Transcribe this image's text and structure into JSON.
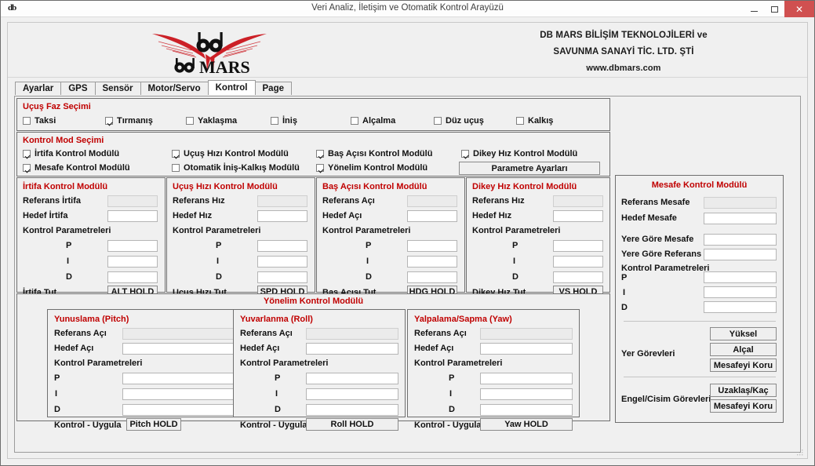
{
  "window": {
    "title": "Veri Analiz, İletişim ve Otomatik Kontrol Arayüzü",
    "icon_text": "db",
    "minimize_label": "",
    "maximize_label": "",
    "close_label": "✕"
  },
  "header": {
    "logo_text": "db MARS",
    "company_line1": "DB MARS BİLİŞİM TEKNOLOJİLERİ ve",
    "company_line2": "SAVUNMA SANAYİ TİC. LTD. ŞTİ",
    "website": "www.dbmars.com"
  },
  "tabs": [
    {
      "label": "Ayarlar",
      "active": false
    },
    {
      "label": "GPS",
      "active": false
    },
    {
      "label": "Sensör",
      "active": false
    },
    {
      "label": "Motor/Servo",
      "active": false
    },
    {
      "label": "Kontrol",
      "active": true
    },
    {
      "label": "Page",
      "active": false
    }
  ],
  "flight_phase": {
    "title": "Uçuş Faz Seçimi",
    "items": [
      {
        "label": "Taksi",
        "checked": false
      },
      {
        "label": "Tırmanış",
        "checked": true
      },
      {
        "label": "Yaklaşma",
        "checked": false
      },
      {
        "label": "İniş",
        "checked": false
      },
      {
        "label": "Alçalma",
        "checked": false
      },
      {
        "label": "Düz uçuş",
        "checked": false
      },
      {
        "label": "Kalkış",
        "checked": false
      }
    ]
  },
  "control_mode": {
    "title": "Kontrol Mod Seçimi",
    "items": [
      {
        "label": "İrtifa Kontrol Modülü",
        "checked": true
      },
      {
        "label": "Uçuş Hızı Kontrol Modülü",
        "checked": true
      },
      {
        "label": "Baş Açısı Kontrol Modülü",
        "checked": true
      },
      {
        "label": "Dikey Hız Kontrol Modülü",
        "checked": true
      },
      {
        "label": "Mesafe Kontrol Modülü",
        "checked": true
      },
      {
        "label": "Otomatik İniş-Kalkış Modülü",
        "checked": false
      },
      {
        "label": "Yönelim Kontrol Modülü",
        "checked": true
      }
    ],
    "param_button": "Parametre Ayarları"
  },
  "modules": [
    {
      "title": "İrtifa Kontrol Modülü",
      "ref_label": "Referans İrtifa",
      "ref_value": "",
      "target_label": "Hedef İrtifa",
      "target_value": "",
      "params_label": "Kontrol Parametreleri",
      "p_label": "P",
      "p_value": "",
      "i_label": "I",
      "i_value": "",
      "d_label": "D",
      "d_value": "",
      "hold_label": "İrtifa Tut",
      "hold_button": "ALT HOLD"
    },
    {
      "title": "Uçuş Hızı Kontrol Modülü",
      "ref_label": "Referans Hız",
      "ref_value": "",
      "target_label": "Hedef Hız",
      "target_value": "",
      "params_label": "Kontrol Parametreleri",
      "p_label": "P",
      "p_value": "",
      "i_label": "I",
      "i_value": "",
      "d_label": "D",
      "d_value": "",
      "hold_label": "Uçuş Hızı Tut",
      "hold_button": "SPD HOLD"
    },
    {
      "title": "Baş Açısı Kontrol Modülü",
      "ref_label": "Referans Açı",
      "ref_value": "",
      "target_label": "Hedef Açı",
      "target_value": "",
      "params_label": "Kontrol Parametreleri",
      "p_label": "P",
      "p_value": "",
      "i_label": "I",
      "i_value": "",
      "d_label": "D",
      "d_value": "",
      "hold_label": "Baş Açısı Tut",
      "hold_button": "HDG HOLD"
    },
    {
      "title": "Dikey Hız Kontrol Modülü",
      "ref_label": "Referans Hız",
      "ref_value": "",
      "target_label": "Hedef Hız",
      "target_value": "",
      "params_label": "Kontrol Parametreleri",
      "p_label": "P",
      "p_value": "",
      "i_label": "I",
      "i_value": "",
      "d_label": "D",
      "d_value": "",
      "hold_label": "Dikey Hız Tut",
      "hold_button": "VS HOLD"
    }
  ],
  "attitude": {
    "title": "Yönelim Kontrol Modülü",
    "axes": [
      {
        "title": "Yunuslama (Pitch)",
        "ref_label": "Referans Açı",
        "ref_value": "",
        "target_label": "Hedef Açı",
        "target_value": "",
        "params_label": "Kontrol Parametreleri",
        "p_label": "P",
        "p_value": "",
        "i_label": "I",
        "i_value": "",
        "d_label": "D",
        "d_value": "",
        "apply_label": "Kontrol - Uygula",
        "apply_button": "Pitch HOLD"
      },
      {
        "title": "Yuvarlanma (Roll)",
        "ref_label": "Referans Açı",
        "ref_value": "",
        "target_label": "Hedef Açı",
        "target_value": "",
        "params_label": "Kontrol Parametreleri",
        "p_label": "P",
        "p_value": "",
        "i_label": "I",
        "i_value": "",
        "d_label": "D",
        "d_value": "",
        "apply_label": "Kontrol - Uygula",
        "apply_button": "Roll HOLD"
      },
      {
        "title": "Yalpalama/Sapma (Yaw)",
        "ref_label": "Referans Açı",
        "ref_value": "",
        "target_label": "Hedef Açı",
        "target_value": "",
        "params_label": "Kontrol Parametreleri",
        "p_label": "P",
        "p_value": "",
        "i_label": "I",
        "i_value": "",
        "d_label": "D",
        "d_value": "",
        "apply_label": "Kontrol - Uygula",
        "apply_button": "Yaw HOLD"
      }
    ]
  },
  "distance": {
    "title": "Mesafe Kontrol Modülü",
    "ref_label": "Referans Mesafe",
    "ref_value": "",
    "target_label": "Hedef Mesafe",
    "target_value": "",
    "ground_dist_label": "Yere Göre Mesafe",
    "ground_dist_value": "",
    "ground_ref_label": "Yere Göre Referans",
    "ground_ref_value": "",
    "params_label": "Kontrol Parametreleri",
    "p_label": "P",
    "p_value": "",
    "i_label": "I",
    "i_value": "",
    "d_label": "D",
    "d_value": "",
    "ground_tasks_label": "Yer Görevleri",
    "ground_tasks": [
      "Yüksel",
      "Alçal",
      "Mesafeyi Koru"
    ],
    "obstacle_tasks_label": "Engel/Cisim Görevleri",
    "obstacle_tasks": [
      "Uzaklaş/Kaç",
      "Mesafeyi Koru"
    ]
  },
  "colors": {
    "accent_red": "#c00000",
    "logo_red": "#cc2027",
    "close_red": "#d05050",
    "panel_bg": "#f0f0f0"
  }
}
